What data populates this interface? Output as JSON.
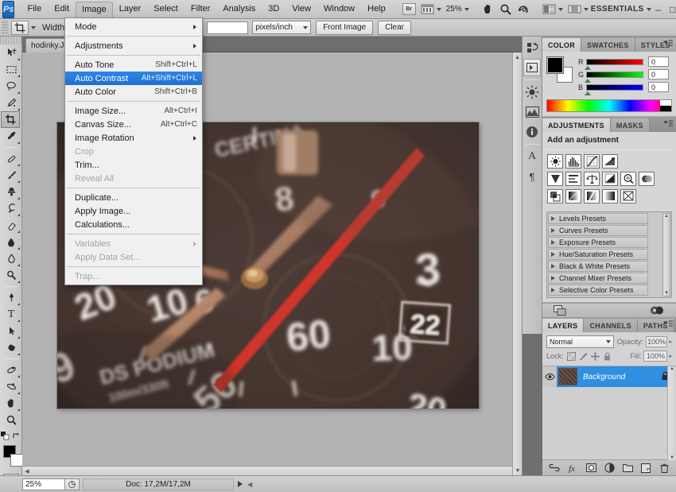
{
  "app": {
    "name": "Adobe Photoshop",
    "logo_text": "Ps",
    "workspace": "ESSENTIALS",
    "zoom_level": "25%"
  },
  "menubar": {
    "items": [
      {
        "label": "File",
        "state": "normal"
      },
      {
        "label": "Edit",
        "state": "normal"
      },
      {
        "label": "Image",
        "state": "open"
      },
      {
        "label": "Layer",
        "state": "normal"
      },
      {
        "label": "Select",
        "state": "normal"
      },
      {
        "label": "Filter",
        "state": "normal"
      },
      {
        "label": "Analysis",
        "state": "normal"
      },
      {
        "label": "3D",
        "state": "normal"
      },
      {
        "label": "View",
        "state": "normal"
      },
      {
        "label": "Window",
        "state": "normal"
      },
      {
        "label": "Help",
        "state": "normal"
      }
    ],
    "bridge_label": "Br",
    "window_controls": {
      "minimize": "–",
      "maximize": "□",
      "close": "✕"
    }
  },
  "image_menu": {
    "title": "Image",
    "items": [
      {
        "label": "Mode",
        "shortcut": "",
        "submenu": true,
        "disabled": false,
        "highlighted": false
      },
      {
        "sep": true
      },
      {
        "label": "Adjustments",
        "shortcut": "",
        "submenu": true,
        "disabled": false,
        "highlighted": false
      },
      {
        "sep": true
      },
      {
        "label": "Auto Tone",
        "shortcut": "Shift+Ctrl+L",
        "submenu": false,
        "disabled": false,
        "highlighted": false
      },
      {
        "label": "Auto Contrast",
        "shortcut": "Alt+Shift+Ctrl+L",
        "submenu": false,
        "disabled": false,
        "highlighted": true
      },
      {
        "label": "Auto Color",
        "shortcut": "Shift+Ctrl+B",
        "submenu": false,
        "disabled": false,
        "highlighted": false
      },
      {
        "sep": true
      },
      {
        "label": "Image Size...",
        "shortcut": "Alt+Ctrl+I",
        "submenu": false,
        "disabled": false,
        "highlighted": false
      },
      {
        "label": "Canvas Size...",
        "shortcut": "Alt+Ctrl+C",
        "submenu": false,
        "disabled": false,
        "highlighted": false
      },
      {
        "label": "Image Rotation",
        "shortcut": "",
        "submenu": true,
        "disabled": false,
        "highlighted": false
      },
      {
        "label": "Crop",
        "shortcut": "",
        "submenu": false,
        "disabled": true,
        "highlighted": false
      },
      {
        "label": "Trim...",
        "shortcut": "",
        "submenu": false,
        "disabled": false,
        "highlighted": false
      },
      {
        "label": "Reveal All",
        "shortcut": "",
        "submenu": false,
        "disabled": true,
        "highlighted": false
      },
      {
        "sep": true
      },
      {
        "label": "Duplicate...",
        "shortcut": "",
        "submenu": false,
        "disabled": false,
        "highlighted": false
      },
      {
        "label": "Apply Image...",
        "shortcut": "",
        "submenu": false,
        "disabled": false,
        "highlighted": false
      },
      {
        "label": "Calculations...",
        "shortcut": "",
        "submenu": false,
        "disabled": false,
        "highlighted": false
      },
      {
        "sep": true
      },
      {
        "label": "Variables",
        "shortcut": "",
        "submenu": true,
        "disabled": true,
        "highlighted": false
      },
      {
        "label": "Apply Data Set...",
        "shortcut": "",
        "submenu": false,
        "disabled": true,
        "highlighted": false
      },
      {
        "sep": true
      },
      {
        "label": "Trap...",
        "shortcut": "",
        "submenu": false,
        "disabled": true,
        "highlighted": false
      }
    ]
  },
  "options_bar": {
    "active_tool": "crop-tool",
    "width_label": "Width:",
    "width_value": "",
    "height_value": "",
    "resolution_value": "",
    "resolution_unit": "pixels/inch",
    "front_image_label": "Front Image",
    "clear_label": "Clear"
  },
  "document": {
    "tab_label": "hodinky.JPG",
    "zoom": "25%",
    "doc_size": "Doc: 17,2M/17,2M"
  },
  "toolbox": {
    "tools": [
      {
        "name": "move-tool",
        "selected": false
      },
      {
        "name": "rectangular-marquee-tool",
        "selected": false
      },
      {
        "name": "lasso-tool",
        "selected": false
      },
      {
        "name": "quick-selection-tool",
        "selected": false
      },
      {
        "name": "crop-tool",
        "selected": true
      },
      {
        "name": "eyedropper-tool",
        "selected": false
      },
      {
        "name": "spot-healing-brush-tool",
        "selected": false
      },
      {
        "name": "brush-tool",
        "selected": false
      },
      {
        "name": "clone-stamp-tool",
        "selected": false
      },
      {
        "name": "history-brush-tool",
        "selected": false
      },
      {
        "name": "eraser-tool",
        "selected": false
      },
      {
        "name": "gradient-tool",
        "selected": false
      },
      {
        "name": "blur-tool",
        "selected": false
      },
      {
        "name": "dodge-tool",
        "selected": false
      },
      {
        "name": "pen-tool",
        "selected": false
      },
      {
        "name": "horizontal-type-tool",
        "selected": false
      },
      {
        "name": "path-selection-tool",
        "selected": false
      },
      {
        "name": "custom-shape-tool",
        "selected": false
      },
      {
        "name": "3d-rotate-tool",
        "selected": false
      },
      {
        "name": "3d-orbit-tool",
        "selected": false
      },
      {
        "name": "hand-tool",
        "selected": false
      },
      {
        "name": "zoom-tool",
        "selected": false
      }
    ],
    "type_tool_glyph": "T",
    "foreground_color": "#000000",
    "background_color": "#ffffff"
  },
  "color_panel": {
    "tabs": [
      {
        "label": "COLOR",
        "active": true
      },
      {
        "label": "SWATCHES",
        "active": false
      },
      {
        "label": "STYLES",
        "active": false
      }
    ],
    "channels": [
      {
        "label": "R",
        "value": "0"
      },
      {
        "label": "G",
        "value": "0"
      },
      {
        "label": "B",
        "value": "0"
      }
    ]
  },
  "adjustments_panel": {
    "tabs": [
      {
        "label": "ADJUSTMENTS",
        "active": true
      },
      {
        "label": "MASKS",
        "active": false
      }
    ],
    "heading": "Add an adjustment",
    "icons_row1": [
      "brightness-contrast-icon",
      "levels-icon",
      "curves-icon",
      "exposure-icon"
    ],
    "icons_row2": [
      "vibrance-icon",
      "hue-saturation-icon",
      "color-balance-icon",
      "black-white-icon",
      "photo-filter-icon",
      "channel-mixer-icon"
    ],
    "icons_row3": [
      "invert-icon",
      "posterize-icon",
      "threshold-icon",
      "gradient-map-icon",
      "selective-color-icon"
    ],
    "presets": [
      "Levels Presets",
      "Curves Presets",
      "Exposure Presets",
      "Hue/Saturation Presets",
      "Black & White Presets",
      "Channel Mixer Presets",
      "Selective Color Presets"
    ]
  },
  "layers_panel": {
    "tabs": [
      {
        "label": "LAYERS",
        "active": true
      },
      {
        "label": "CHANNELS",
        "active": false
      },
      {
        "label": "PATHS",
        "active": false
      }
    ],
    "blend_mode": "Normal",
    "opacity_label": "Opacity:",
    "opacity_value": "100%",
    "lock_label": "Lock:",
    "fill_label": "Fill:",
    "fill_value": "100%",
    "layers": [
      {
        "name": "Background",
        "visible": true,
        "locked": true,
        "selected": true
      }
    ],
    "footer_icons": [
      "link-layers-icon",
      "layer-style-icon",
      "layer-mask-icon",
      "new-adjustment-layer-icon",
      "new-group-icon",
      "new-layer-icon",
      "delete-layer-icon"
    ]
  },
  "icon_dock": {
    "buttons": [
      "mini-bridge-icon",
      "collapse-panel-icon",
      "adjustments-dock-icon",
      "histogram-icon",
      "info-icon",
      "character-icon",
      "paragraph-icon"
    ],
    "character_glyph": "A",
    "paragraph_glyph": "¶"
  },
  "canvas": {
    "image_description": "Close-up photograph of a Certina DS Podium chronograph watch face",
    "watch_brand_text": "DS PODIUM",
    "watch_depth_text": "100m/330ft",
    "date_window": "22",
    "dial_numbers": [
      "3",
      "6",
      "8",
      "9",
      "10",
      "20",
      "50",
      "60"
    ]
  }
}
